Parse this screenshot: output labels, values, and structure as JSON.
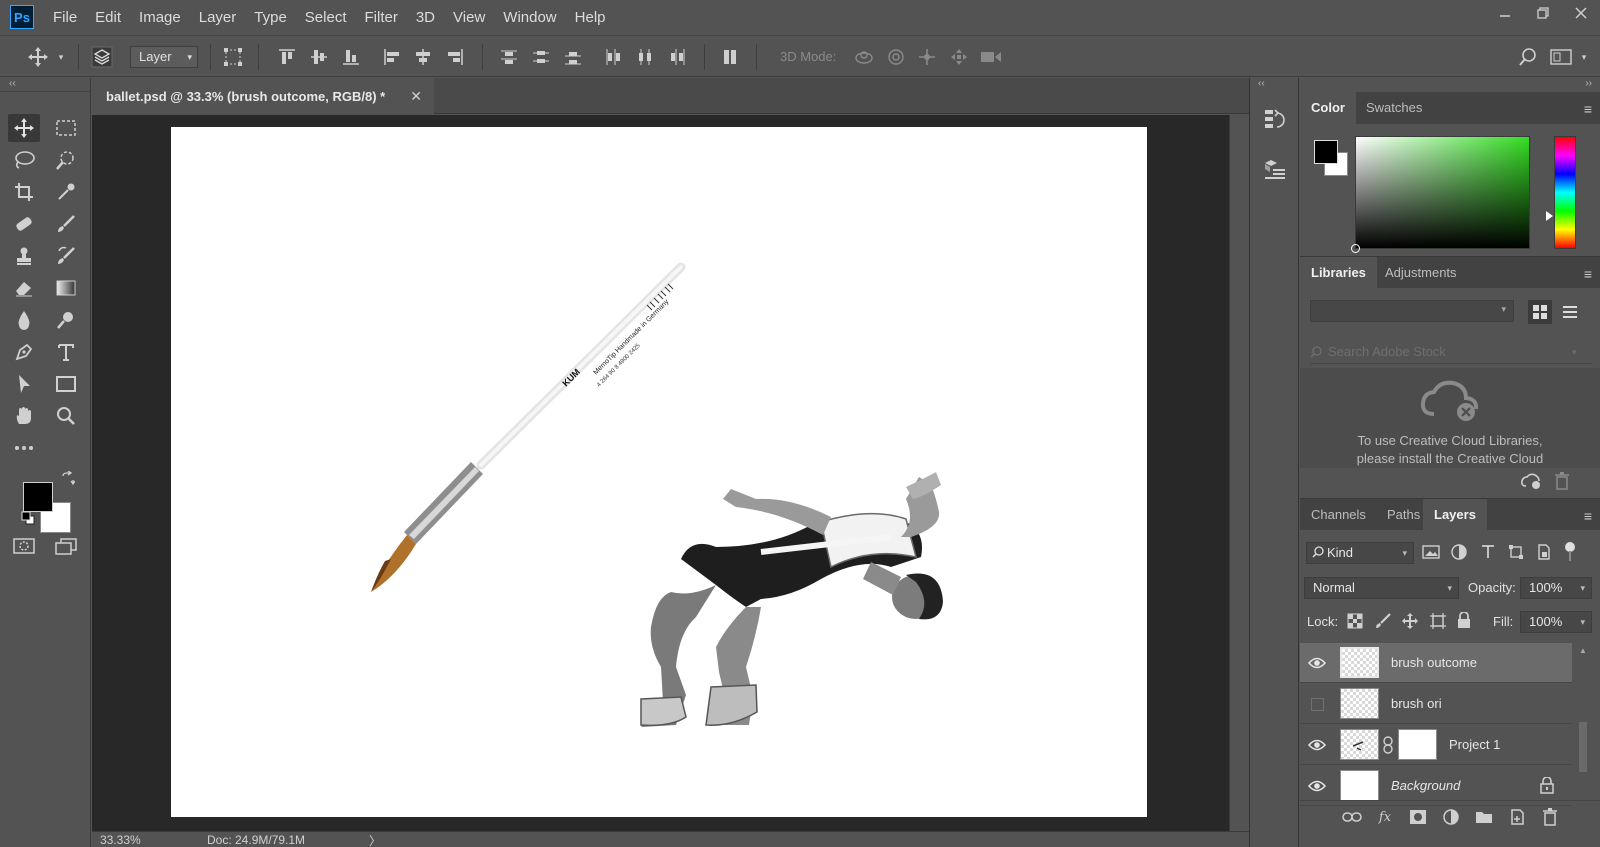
{
  "app": {
    "logo": "Ps",
    "menu": [
      "File",
      "Edit",
      "Image",
      "Layer",
      "Type",
      "Select",
      "Filter",
      "3D",
      "View",
      "Window",
      "Help"
    ],
    "window_controls": [
      "minimize-icon",
      "restore-icon",
      "close-icon"
    ]
  },
  "options_bar": {
    "auto_select_target": "Layer",
    "mode_3d_label": "3D Mode:"
  },
  "document": {
    "tab_title": "ballet.psd @ 33.3% (brush outcome, RGB/8) *",
    "canvas_text": {
      "brush_brand": "KUM",
      "brush_line1": "MemoTip  Handmade in Germany",
      "brush_line2": "4 264 90 8 4900 2425"
    }
  },
  "status": {
    "zoom": "33.33%",
    "doc_size": "Doc: 24.9M/79.1M",
    "arrow": "〉"
  },
  "color_panel": {
    "tabs": [
      "Color",
      "Swatches"
    ],
    "active_tab": "Color",
    "foreground": "#000000",
    "background": "#ffffff"
  },
  "libraries_panel": {
    "tabs": [
      "Libraries",
      "Adjustments"
    ],
    "active_tab": "Libraries",
    "search_placeholder": "Search Adobe Stock",
    "message_line1": "To use Creative Cloud Libraries,",
    "message_line2": "please install the Creative Cloud"
  },
  "layers_panel": {
    "tabs": [
      "Channels",
      "Paths",
      "Layers"
    ],
    "active_tab": "Layers",
    "filter_kind": "Kind",
    "blend_mode": "Normal",
    "opacity_label": "Opacity:",
    "opacity_value": "100%",
    "lock_label": "Lock:",
    "fill_label": "Fill:",
    "fill_value": "100%",
    "layers": [
      {
        "name": "brush outcome",
        "visible": true,
        "selected": true
      },
      {
        "name": "brush ori",
        "visible": false,
        "selected": false
      },
      {
        "name": "Project 1",
        "visible": true,
        "selected": false
      },
      {
        "name": "Background",
        "visible": true,
        "selected": false,
        "locked": true
      }
    ]
  }
}
